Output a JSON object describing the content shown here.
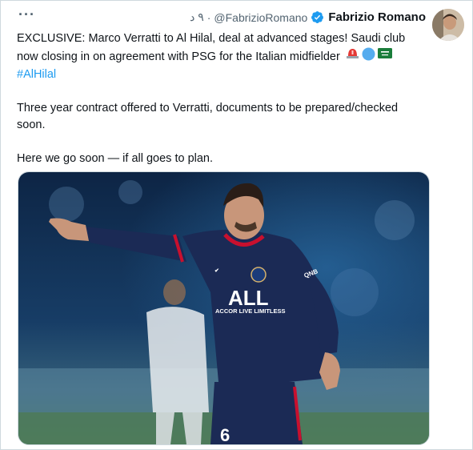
{
  "tweet": {
    "author_name": "Fabrizio Romano",
    "handle": "@FabrizioRomano",
    "separator": "·",
    "time": "٩ د",
    "text_line1": "EXCLUSIVE: Marco Verratti to Al Hilal, deal at advanced stages! Saudi club now closing in on agreement with PSG for the Italian midfielder",
    "hashtag": "#AlHilal",
    "paragraph2": "Three year contract offered to Verratti, documents to be prepared/checked soon.",
    "paragraph3": "Here we go soon — if all goes to plan.",
    "emojis": [
      "siren-emoji",
      "blue-circle-emoji",
      "saudi-flag-emoji"
    ]
  },
  "ui": {
    "more_label": "···",
    "icons": {
      "verified": "verified-badge-icon",
      "more": "more-icon"
    },
    "colors": {
      "link": "#1d9bf0",
      "secondary_text": "#536471",
      "primary_text": "#0f1419",
      "verified": "#1d9bf0",
      "jersey": "#1b2a55"
    }
  },
  "media": {
    "jersey_sponsor_line1": "ALL",
    "jersey_sponsor_line2": "ACCOR LIVE LIMITLESS",
    "jersey_number": "6",
    "sleeve_text": "QNB"
  }
}
